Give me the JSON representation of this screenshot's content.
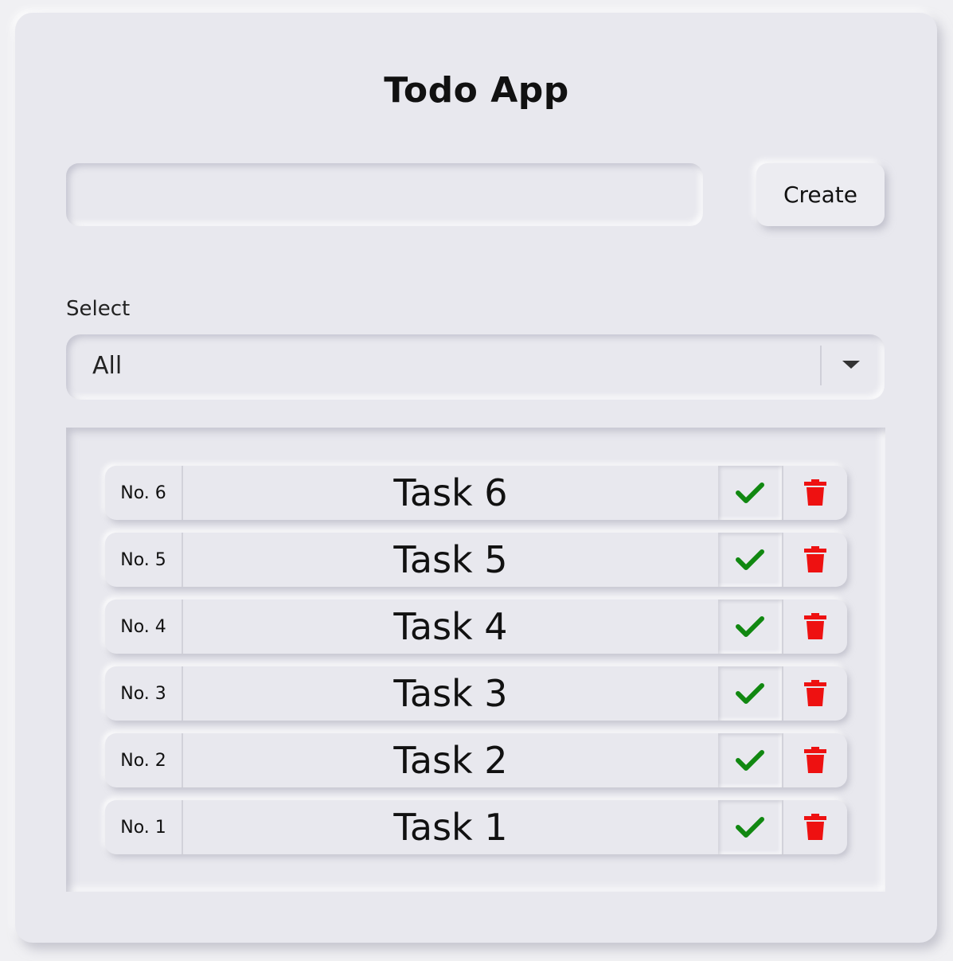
{
  "app": {
    "title": "Todo App"
  },
  "create": {
    "input_value": "",
    "placeholder": "",
    "button_label": "Create"
  },
  "filter": {
    "label": "Select",
    "selected": "All"
  },
  "todos": [
    {
      "number": "No. 6",
      "text": "Task 6"
    },
    {
      "number": "No. 5",
      "text": "Task 5"
    },
    {
      "number": "No. 4",
      "text": "Task 4"
    },
    {
      "number": "No. 3",
      "text": "Task 3"
    },
    {
      "number": "No. 2",
      "text": "Task 2"
    },
    {
      "number": "No. 1",
      "text": "Task 1"
    }
  ],
  "icons": {
    "complete": "check-icon",
    "delete": "trash-icon"
  },
  "colors": {
    "check": "#118811",
    "delete": "#ee1111",
    "background": "#e8e8ee"
  }
}
